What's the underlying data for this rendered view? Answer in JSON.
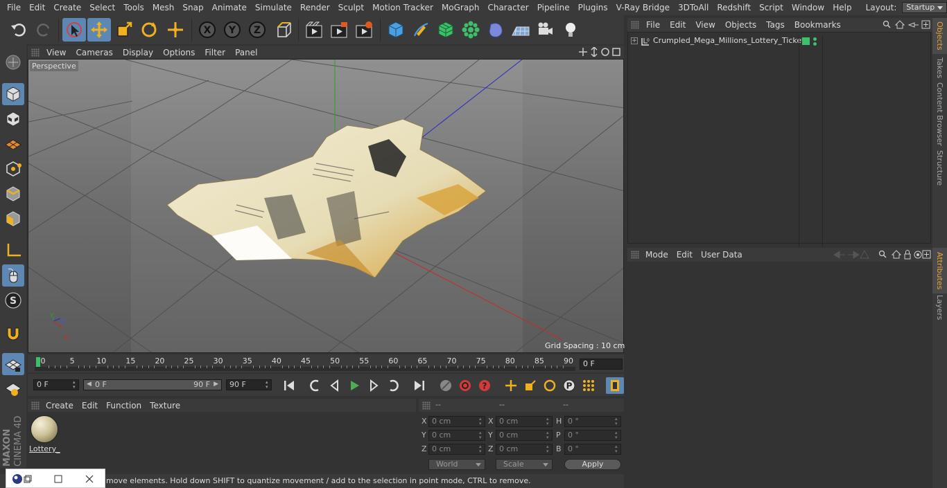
{
  "menu": {
    "items": [
      "File",
      "Edit",
      "Create",
      "Select",
      "Tools",
      "Mesh",
      "Snap",
      "Animate",
      "Simulate",
      "Render",
      "Sculpt",
      "Motion Tracker",
      "MoGraph",
      "Character",
      "Pipeline",
      "Plugins",
      "V-Ray Bridge",
      "3DToAll",
      "Redshift",
      "Script",
      "Window",
      "Help"
    ],
    "layout_label": "Layout:",
    "layout_value": "Startup"
  },
  "toolbar": {
    "icons": [
      "undo-icon",
      "redo-icon",
      "live-selection-icon",
      "move-icon",
      "scale-icon",
      "rotate-icon",
      "transform-icon",
      "x-axis-icon",
      "y-axis-icon",
      "z-axis-icon",
      "coordinate-system-icon",
      "render-view-icon",
      "render-picture-viewer-icon",
      "render-settings-icon",
      "cube-icon",
      "pen-icon",
      "subdivision-icon",
      "cloner-icon",
      "deformer-icon",
      "floor-icon",
      "camera-icon",
      "light-icon"
    ],
    "axis_x": "X",
    "axis_y": "Y",
    "axis_z": "Z"
  },
  "viewport": {
    "menu": [
      "View",
      "Cameras",
      "Display",
      "Options",
      "Filter",
      "Panel"
    ],
    "label": "Perspective",
    "grid_spacing": "Grid Spacing : 10 cm",
    "axis_x": "X",
    "axis_y": "Y",
    "axis_z": "Z"
  },
  "timeline": {
    "ticks": [
      "0",
      "5",
      "10",
      "15",
      "20",
      "25",
      "30",
      "35",
      "40",
      "45",
      "50",
      "55",
      "60",
      "65",
      "70",
      "75",
      "80",
      "85",
      "90"
    ],
    "current_frame": "0 F",
    "start_field": "0 F",
    "range_start": "0 F",
    "range_end": "90 F",
    "end_field": "90 F"
  },
  "material": {
    "menu": [
      "Create",
      "Edit",
      "Function",
      "Texture"
    ],
    "name": "Lottery_"
  },
  "coords": {
    "headers": [
      "--",
      "--",
      "--"
    ],
    "rows": [
      {
        "l1": "X",
        "v1": "0 cm",
        "l2": "X",
        "v2": "0 cm",
        "l3": "H",
        "v3": "0 °"
      },
      {
        "l1": "Y",
        "v1": "0 cm",
        "l2": "Y",
        "v2": "0 cm",
        "l3": "P",
        "v3": "0 °"
      },
      {
        "l1": "Z",
        "v1": "0 cm",
        "l2": "Z",
        "v2": "0 cm",
        "l3": "B",
        "v3": "0 °"
      }
    ],
    "space": "World",
    "mode": "Scale",
    "apply": "Apply"
  },
  "objects": {
    "menu": [
      "File",
      "Edit",
      "View",
      "Objects",
      "Tags",
      "Bookmarks"
    ],
    "items": [
      {
        "name": "Crumpled_Mega_Millions_Lottery_Ticket"
      }
    ]
  },
  "attributes": {
    "menu": [
      "Mode",
      "Edit",
      "User Data"
    ]
  },
  "right_tabs": [
    "Objects",
    "Takes",
    "Content Browser",
    "Structure",
    "Attributes",
    "Layers"
  ],
  "status": "move elements. Hold down SHIFT to quantize movement / add to the selection in point mode, CTRL to remove.",
  "brand": {
    "vendor": "MAXON",
    "product": "CINEMA 4D"
  },
  "colors": {
    "selected": "#5d88b3",
    "accent": "#e8a23a",
    "play": "#4caf50",
    "record": "#d43a3a"
  }
}
